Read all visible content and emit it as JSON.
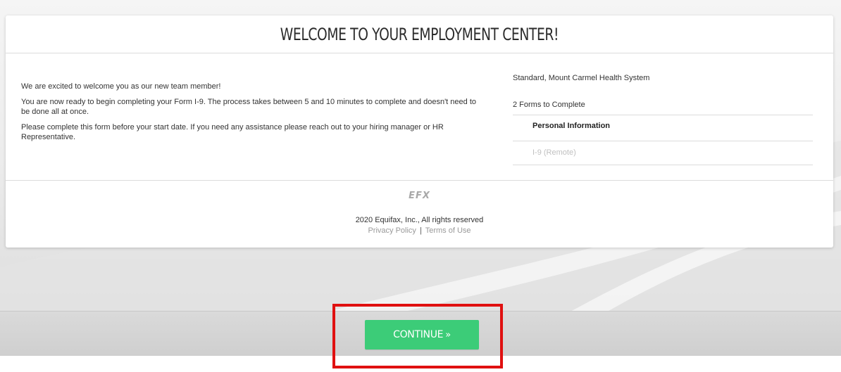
{
  "header": {
    "title": "WELCOME TO YOUR EMPLOYMENT CENTER!"
  },
  "welcome": {
    "line1": "We are excited to welcome you as our new team member!",
    "line2": "You are now ready to begin completing your Form I-9. The process takes between 5 and 10 minutes to complete and doesn't need to be done all at once.",
    "line3": "Please complete this form before your start date. If you need any assistance please reach out to your hiring manager or HR Representative."
  },
  "sidebar": {
    "company": "Standard, Mount Carmel Health System",
    "forms_count": "2 Forms to Complete",
    "forms": [
      {
        "label": "Personal Information",
        "state": "active"
      },
      {
        "label": "I-9 (Remote)",
        "state": "disabled"
      }
    ]
  },
  "footer": {
    "logo_text": "EFX",
    "copyright": "2020 Equifax, Inc., All rights reserved",
    "privacy_label": "Privacy Policy",
    "separator": "|",
    "terms_label": "Terms of Use"
  },
  "actions": {
    "continue_label": "CONTINUE",
    "continue_glyph": "»"
  },
  "colors": {
    "continue_button": "#3ccc78",
    "highlight_box": "#e01010"
  }
}
